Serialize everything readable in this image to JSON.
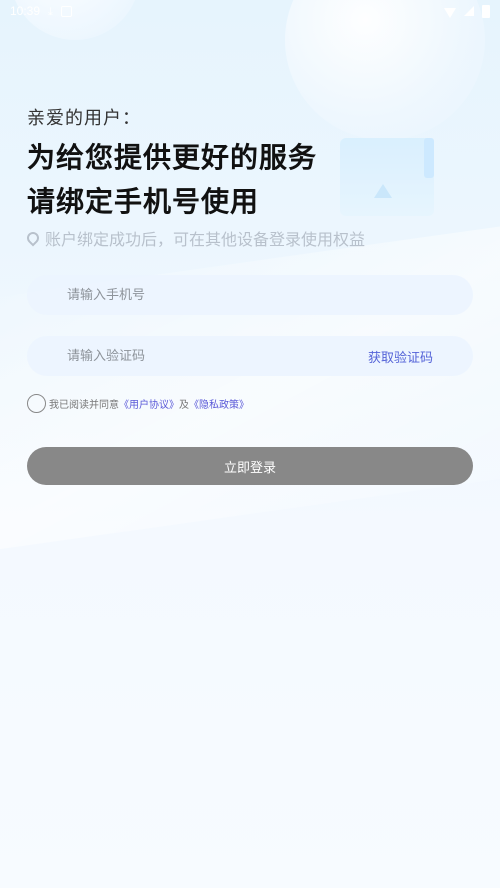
{
  "status_bar": {
    "time": "10:39",
    "icons": [
      "download-icon",
      "notification-icon",
      "wifi-icon",
      "signal-icon",
      "battery-icon"
    ]
  },
  "greeting": "亲爱的用户：",
  "heading_line1": "为给您提供更好的服务",
  "heading_line2": "请绑定手机号使用",
  "note": "账户绑定成功后，可在其他设备登录使用权益",
  "phone": {
    "placeholder": "请输入手机号",
    "value": ""
  },
  "code": {
    "placeholder": "请输入验证码",
    "value": "",
    "get_code_label": "获取验证码"
  },
  "agreement": {
    "prefix": "我已阅读并同意",
    "user_agreement": "《用户协议》",
    "and": "及",
    "privacy_policy": "《隐私政策》",
    "checked": false
  },
  "login_button": "立即登录",
  "colors": {
    "accent_link": "#5463d8",
    "button_disabled": "#888888",
    "background": "#eef7fe"
  }
}
